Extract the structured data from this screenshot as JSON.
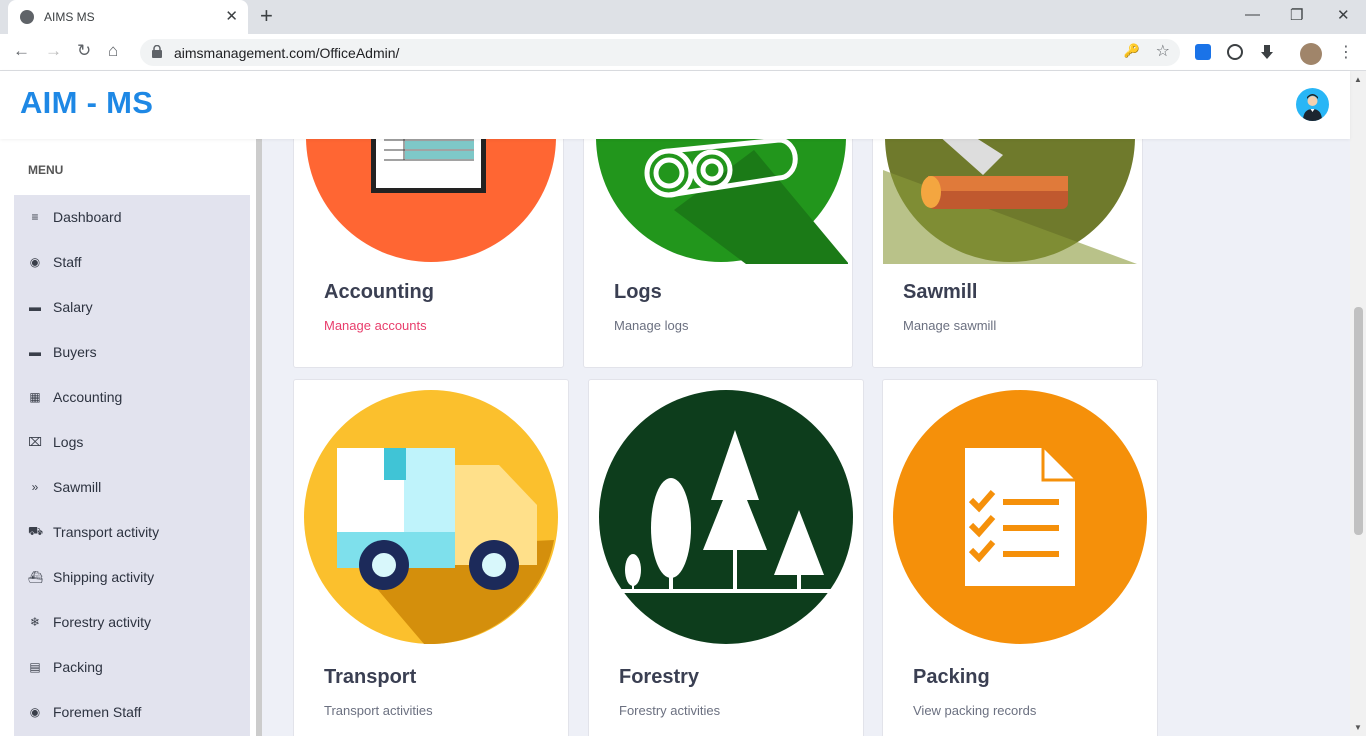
{
  "browser": {
    "tab_title": "AIMS MS",
    "tab_close": "✕",
    "new_tab": "+",
    "url": "aimsmanagement.com/OfficeAdmin/",
    "window_controls": {
      "minimize": "—",
      "maximize": "❐",
      "close": "✕"
    }
  },
  "app": {
    "brand": "AIM - MS"
  },
  "sidebar": {
    "menu_title": "MENU",
    "items": [
      {
        "label": "Dashboard",
        "icon": "≡"
      },
      {
        "label": "Staff",
        "icon": "◉"
      },
      {
        "label": "Salary",
        "icon": "▬"
      },
      {
        "label": "Buyers",
        "icon": "▬"
      },
      {
        "label": "Accounting",
        "icon": "▦"
      },
      {
        "label": "Logs",
        "icon": "⌧"
      },
      {
        "label": "Sawmill",
        "icon": "»"
      },
      {
        "label": "Transport activity",
        "icon": "⛟"
      },
      {
        "label": "Shipping activity",
        "icon": "⛴"
      },
      {
        "label": "Forestry activity",
        "icon": "❄"
      },
      {
        "label": "Packing",
        "icon": "▤"
      },
      {
        "label": "Foremen Staff",
        "icon": "◉"
      }
    ]
  },
  "cards": [
    {
      "title": "Accounting",
      "subtitle": "Manage accounts",
      "color": "#ff6633",
      "icon": "ledger-icon"
    },
    {
      "title": "Logs",
      "subtitle": "Manage logs",
      "color": "#22961c",
      "icon": "logs-icon"
    },
    {
      "title": "Sawmill",
      "subtitle": "Manage sawmill",
      "color": "#6f7a2c",
      "icon": "axe-log-icon"
    },
    {
      "title": "Transport",
      "subtitle": "Transport activities",
      "color": "#fbc02d",
      "icon": "truck-icon"
    },
    {
      "title": "Forestry",
      "subtitle": "Forestry activities",
      "color": "#0d3d1c",
      "icon": "trees-icon"
    },
    {
      "title": "Packing",
      "subtitle": "View packing records",
      "color": "#f5900a",
      "icon": "checklist-icon"
    }
  ]
}
